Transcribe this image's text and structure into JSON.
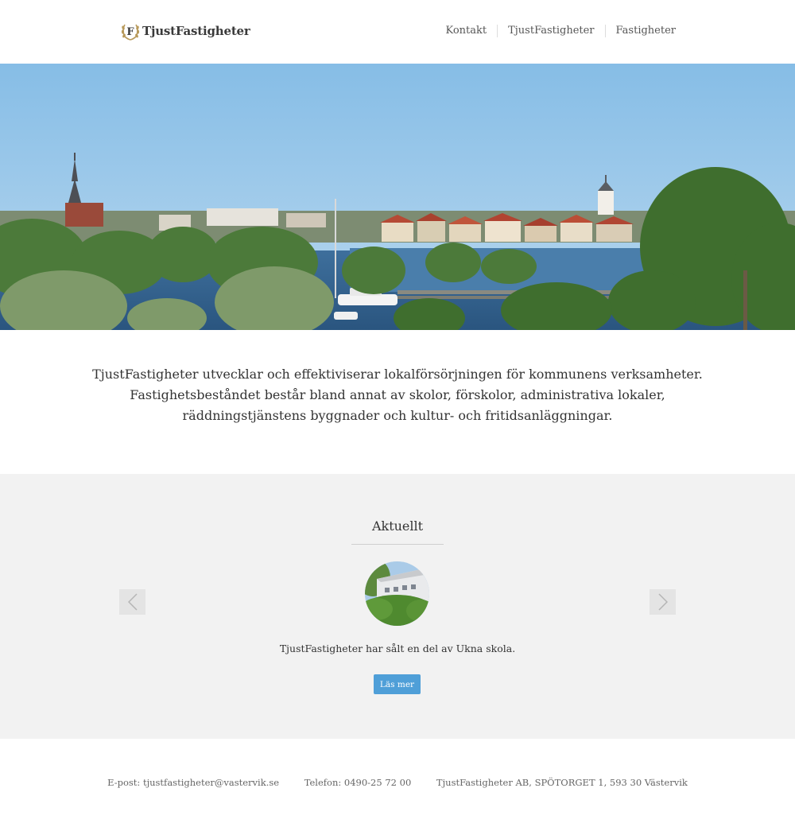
{
  "header": {
    "logo_letter": "F",
    "logo_text": "TjustFastigheter",
    "nav": [
      {
        "label": "Kontakt"
      },
      {
        "label": "TjustFastigheter"
      },
      {
        "label": "Fastigheter"
      }
    ]
  },
  "intro": {
    "lines": [
      "TjustFastigheter utvecklar och effektiviserar lokalförsörjningen för kommunens verksamheter.",
      "Fastighetsbeståndet består bland annat av skolor, förskolor, administrativa lokaler,",
      "räddningstjänstens byggnader och kultur- och fritidsanläggningar."
    ]
  },
  "news": {
    "title": "Aktuellt",
    "item_text": "TjustFastigheter har sålt en del av Ukna skola.",
    "button_label": "Läs mer",
    "prev_icon": "chevron-left-icon",
    "next_icon": "chevron-right-icon"
  },
  "footer": {
    "email": "E-post: tjustfastigheter@vastervik.se",
    "phone": "Telefon: 0490-25 72 00",
    "address": "TjustFastigheter AB, SPÖTORGET 1, 593 30 Västervik"
  },
  "colors": {
    "accent": "#4f9fd8",
    "logo_gold": "#b8995a",
    "section_bg": "#f2f2f2"
  }
}
